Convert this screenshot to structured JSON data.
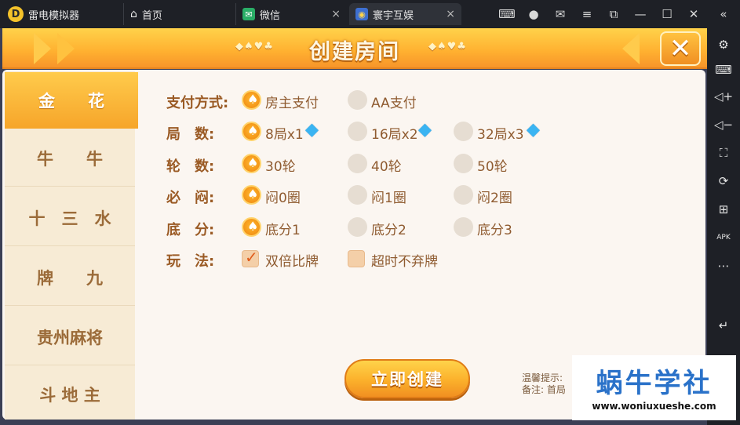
{
  "titlebar": {
    "app_name": "雷电模拟器",
    "app_logo": "D",
    "tabs": [
      {
        "label": "首页",
        "icon": "home-icon"
      },
      {
        "label": "微信",
        "icon": "wechat-icon"
      },
      {
        "label": "寰宇互娱",
        "icon": "game-icon",
        "active": true
      }
    ],
    "tab_close": "×"
  },
  "dialog": {
    "title": "创建房间",
    "left_deco": "◆♠♥♣",
    "right_deco": "◆♠♥♣",
    "close_glyph": "✕"
  },
  "categories": [
    {
      "label": "金　　花",
      "selected": true
    },
    {
      "label": "牛　　牛"
    },
    {
      "label": "十　三　水"
    },
    {
      "label": "牌　　九"
    },
    {
      "label": "贵州麻将"
    },
    {
      "label": "斗 地 主"
    }
  ],
  "options": {
    "payment": {
      "label": "支付方式:",
      "choices": [
        "房主支付",
        "AA支付"
      ],
      "selected": 0
    },
    "rounds": {
      "label": "局　数:",
      "choices": [
        "8局x1",
        "16局x2",
        "32局x3"
      ],
      "selected": 0
    },
    "turns": {
      "label": "轮　数:",
      "choices": [
        "30轮",
        "40轮",
        "50轮"
      ],
      "selected": 0
    },
    "must_stuffy": {
      "label": "必　闷:",
      "choices": [
        "闷0圈",
        "闷1圈",
        "闷2圈"
      ],
      "selected": 0
    },
    "base_score": {
      "label": "底　分:",
      "choices": [
        "底分1",
        "底分2",
        "底分3"
      ],
      "selected": 0
    },
    "rules": {
      "label": "玩　法:",
      "choices": [
        "双倍比牌",
        "超时不弃牌"
      ],
      "checked": [
        true,
        false
      ]
    }
  },
  "create_button": "立即创建",
  "tips": {
    "line1": "温馨提示:",
    "line2": "备注: 首局"
  },
  "watermark": {
    "main": "蜗牛学社",
    "sub": "www.woniuxueshe.com"
  },
  "colors": {
    "accent": "#f6a52a",
    "label": "#9a5a24",
    "gem": "#3ab4f2"
  }
}
